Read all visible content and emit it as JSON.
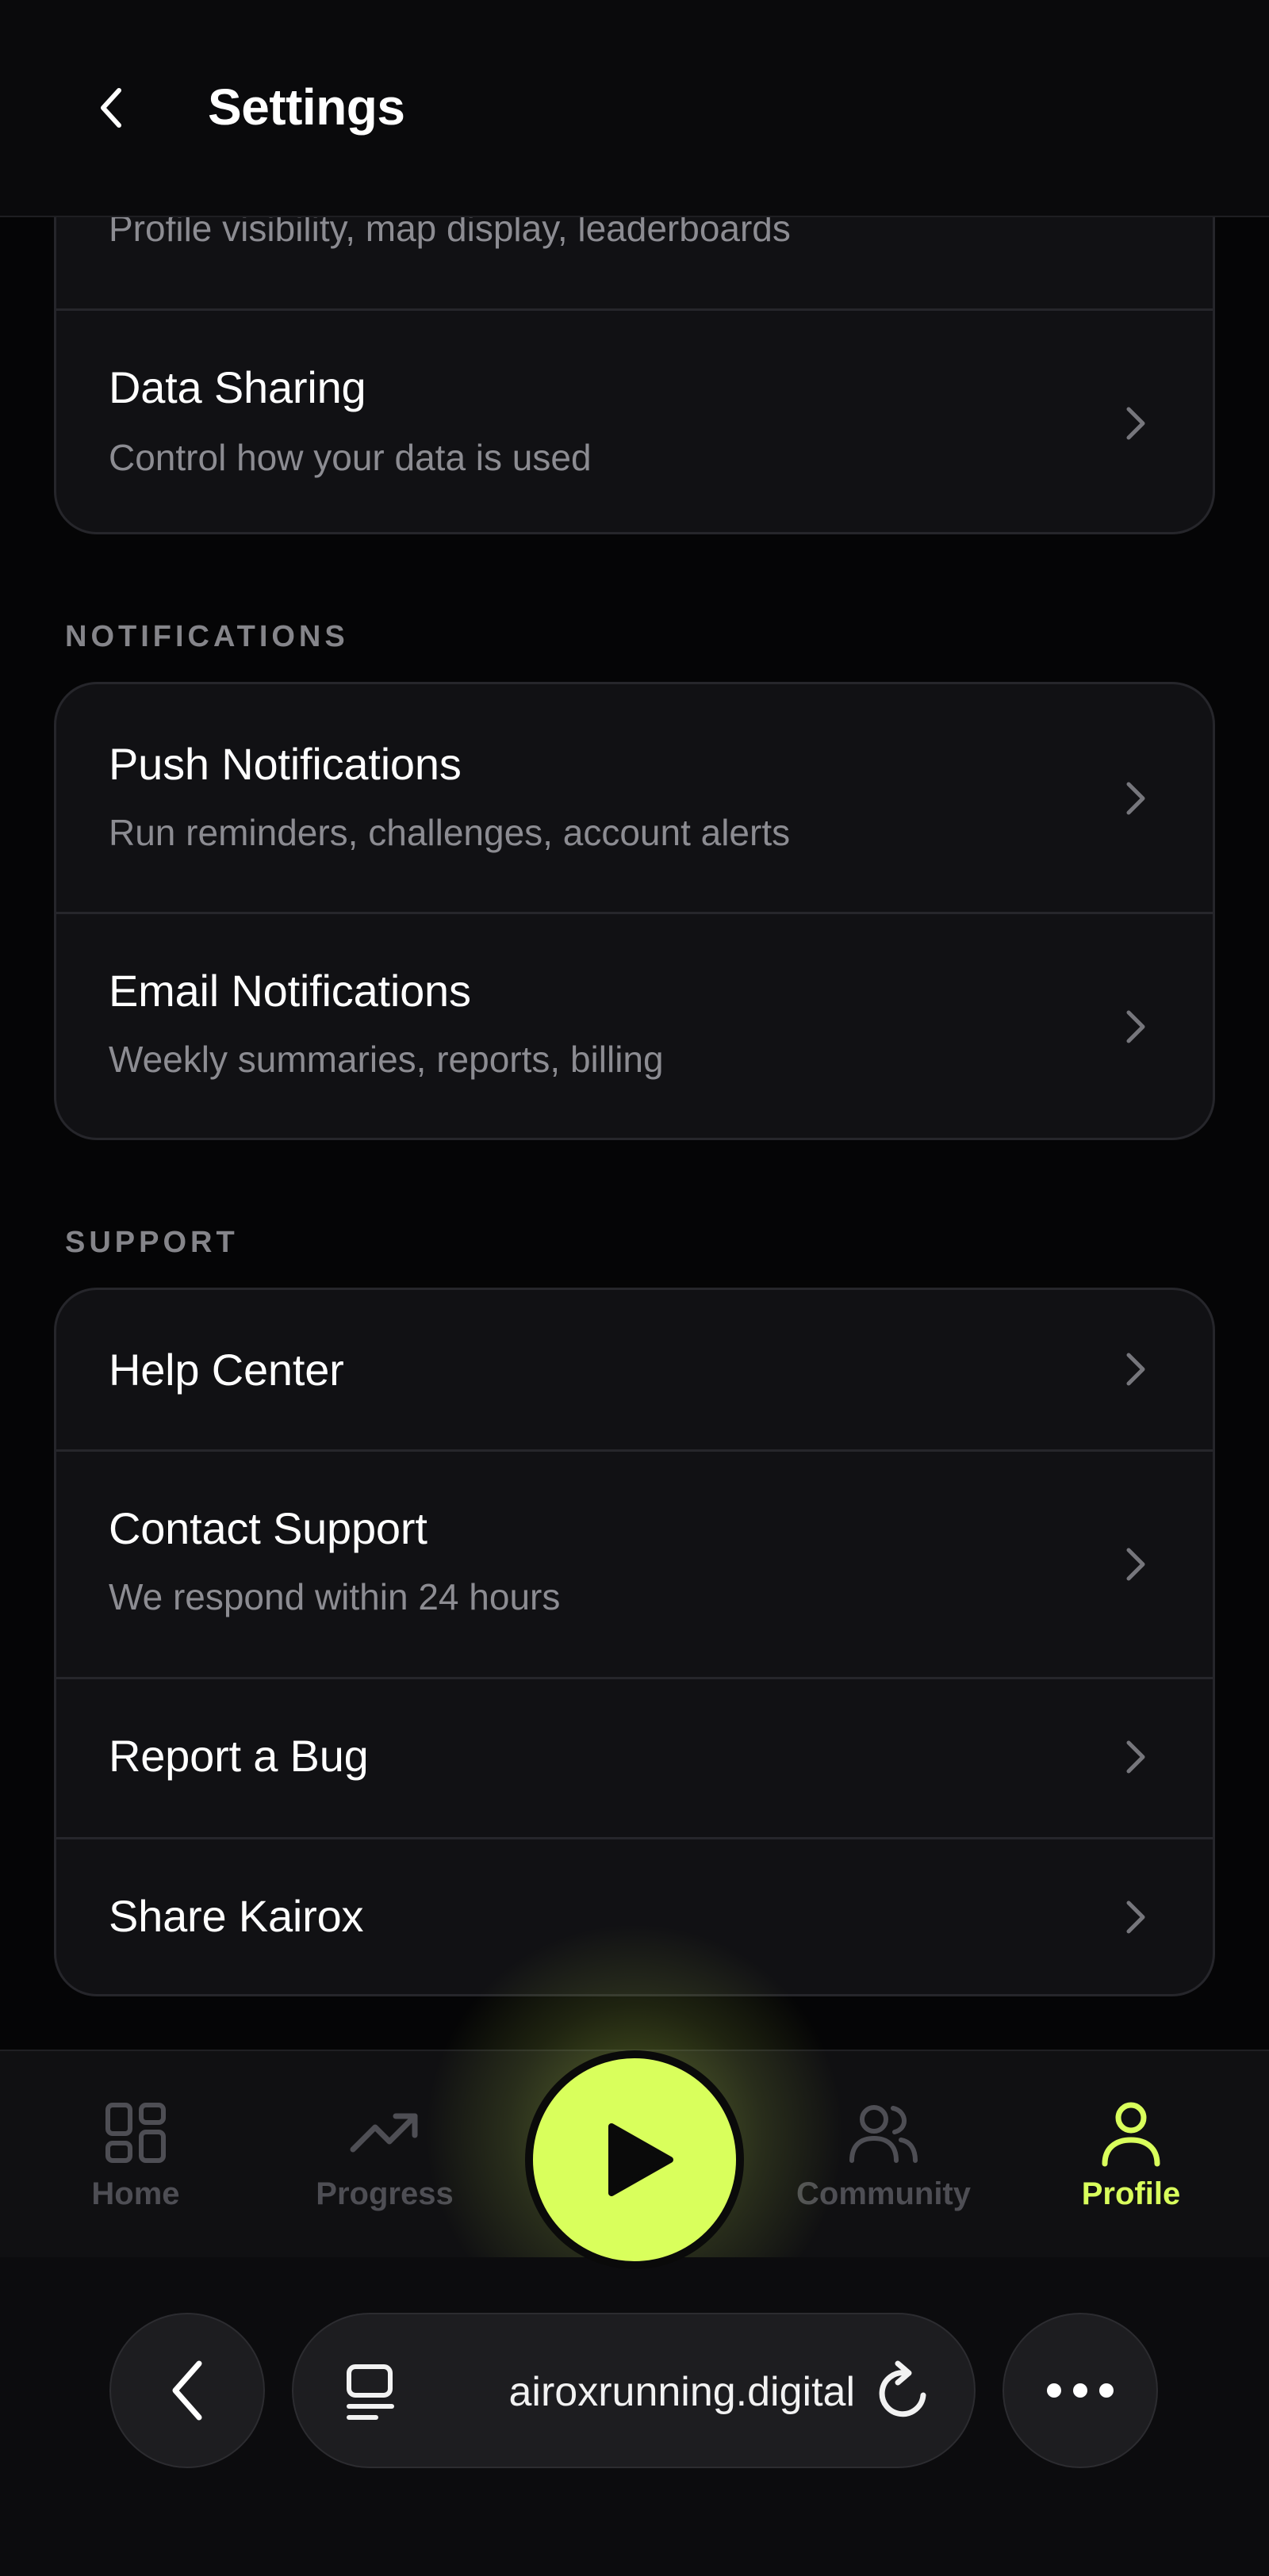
{
  "header": {
    "title": "Settings"
  },
  "privacy_card": {
    "rows": [
      {
        "subtitle": "Profile visibility, map display, leaderboards"
      },
      {
        "title": "Data Sharing",
        "subtitle": "Control how your data is used"
      }
    ]
  },
  "notifications": {
    "label": "NOTIFICATIONS",
    "rows": [
      {
        "title": "Push Notifications",
        "subtitle": "Run reminders, challenges, account alerts"
      },
      {
        "title": "Email Notifications",
        "subtitle": "Weekly summaries, reports, billing"
      }
    ]
  },
  "support": {
    "label": "SUPPORT",
    "rows": [
      {
        "title": "Help Center"
      },
      {
        "title": "Contact Support",
        "subtitle": "We respond within 24 hours"
      },
      {
        "title": "Report a Bug"
      },
      {
        "title": "Share Kairox"
      }
    ]
  },
  "bottom_nav": {
    "items": [
      {
        "label": "Home",
        "icon": "grid-icon"
      },
      {
        "label": "Progress",
        "icon": "trend-up-icon"
      },
      {
        "label": "Community",
        "icon": "users-icon"
      },
      {
        "label": "Profile",
        "icon": "user-icon",
        "active": true
      }
    ],
    "play_icon": "play-icon"
  },
  "browser": {
    "url": "airoxrunning.digital"
  },
  "colors": {
    "accent": "#d9ff5c",
    "background": "#050506",
    "card": "#111114",
    "muted_text": "#8c8c92"
  }
}
